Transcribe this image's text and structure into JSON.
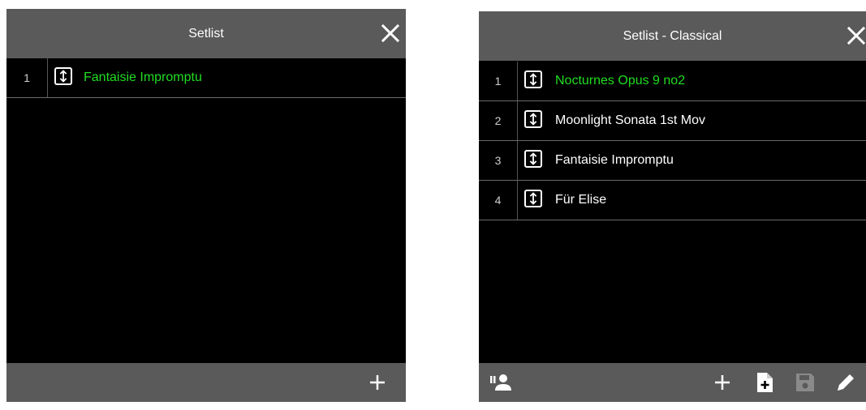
{
  "left_panel": {
    "title": "Setlist",
    "close_icon": "close-icon",
    "rows": [
      {
        "number": "1",
        "title": "Fantaisie Impromptu",
        "active": true
      }
    ],
    "footer": {
      "add_icon": "plus-icon"
    }
  },
  "right_panel": {
    "title": "Setlist - Classical",
    "close_icon": "close-icon",
    "rows": [
      {
        "number": "1",
        "title": "Nocturnes Opus 9 no2",
        "active": true
      },
      {
        "number": "2",
        "title": "Moonlight Sonata 1st Mov",
        "active": false
      },
      {
        "number": "3",
        "title": "Fantaisie Impromptu",
        "active": false
      },
      {
        "number": "4",
        "title": "Für Elise",
        "active": false
      }
    ],
    "footer": {
      "left_icon": "setlist-performer-icon",
      "right_icons": [
        "plus-icon",
        "add-file-icon",
        "save-icon",
        "edit-pencil-icon"
      ]
    }
  },
  "colors": {
    "active_title": "#22dd22",
    "header_bg": "#5a5a5a",
    "list_bg": "#000000",
    "save_disabled": "#8a8a8a"
  }
}
